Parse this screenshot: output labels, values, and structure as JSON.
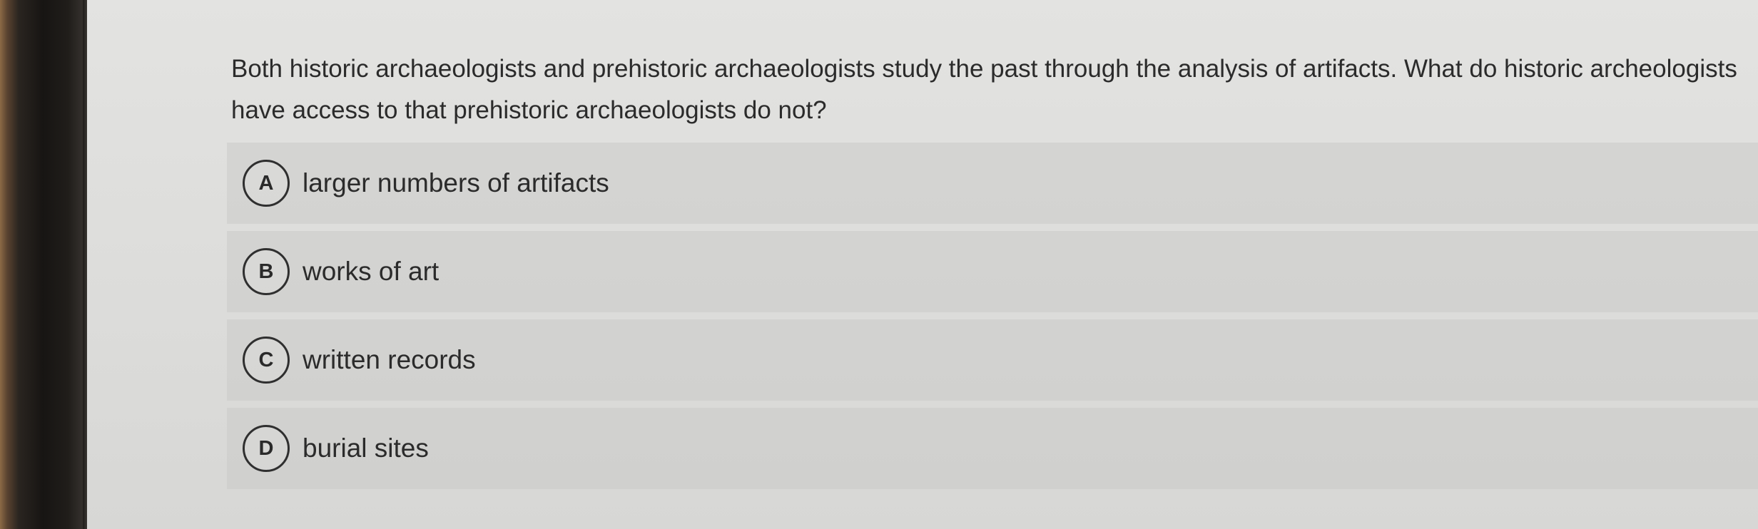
{
  "question": {
    "text": "Both historic archaeologists and prehistoric archaeologists study the past through the analysis of artifacts. What do historic archeologists have access to that prehistoric archaeologists do not?"
  },
  "choices": [
    {
      "letter": "A",
      "text": "larger numbers of artifacts"
    },
    {
      "letter": "B",
      "text": "works of art"
    },
    {
      "letter": "C",
      "text": "written records"
    },
    {
      "letter": "D",
      "text": "burial sites"
    }
  ]
}
